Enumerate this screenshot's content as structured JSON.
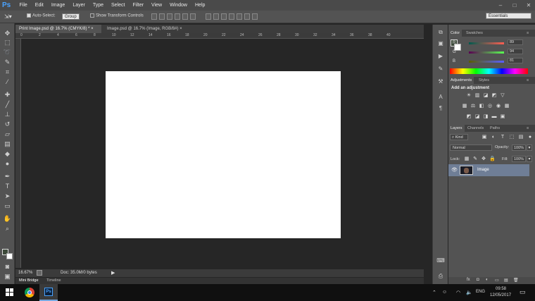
{
  "app": {
    "logo": "Ps"
  },
  "menubar": {
    "items": [
      "File",
      "Edit",
      "Image",
      "Layer",
      "Type",
      "Select",
      "Filter",
      "View",
      "Window",
      "Help"
    ],
    "window_controls": [
      "–",
      "□",
      "✕"
    ]
  },
  "options": {
    "auto_select_label": "Auto-Select:",
    "auto_select_value": "Group",
    "transform_label": "Show Transform Controls",
    "workspace": "Essentials"
  },
  "tabs": [
    {
      "label": "Print Image.psd @ 16.7% (CMYK/8) *",
      "close": "×"
    },
    {
      "label": "Image.psd @ 16.7% (Image, RGB/8#)",
      "close": "×"
    }
  ],
  "ruler_ticks": [
    "0",
    "2",
    "4",
    "6",
    "8",
    "10",
    "12",
    "14",
    "16",
    "18",
    "20",
    "22",
    "24",
    "26",
    "28",
    "30",
    "32",
    "34",
    "36",
    "38",
    "40"
  ],
  "status": {
    "zoom": "16.67%",
    "doc": "Doc: 35.0M/0 bytes"
  },
  "bottom_tabs": [
    "Mini Bridge",
    "Timeline"
  ],
  "color_panel": {
    "tabs": [
      "Color",
      "Swatches"
    ],
    "r_label": "R",
    "r_value": "89",
    "g_label": "G",
    "g_value": "94",
    "b_label": "B",
    "b_value": "81"
  },
  "adjustments_panel": {
    "tabs": [
      "Adjustments",
      "Styles"
    ],
    "heading": "Add an adjustment"
  },
  "layers_panel": {
    "tabs": [
      "Layers",
      "Channels",
      "Paths"
    ],
    "kind_label": "Kind",
    "blend_mode": "Normal",
    "opacity_label": "Opacity:",
    "opacity_value": "100%",
    "lock_label": "Lock:",
    "fill_label": "Fill:",
    "fill_value": "100%",
    "layer_name": "Image"
  },
  "taskbar": {
    "language": "ENG",
    "time": "09:58",
    "date": "12/05/2017"
  },
  "colors": {
    "accent_ps": "#4aa3ff",
    "selected_layer": "#6f7e96",
    "canvas": "#ffffff"
  }
}
